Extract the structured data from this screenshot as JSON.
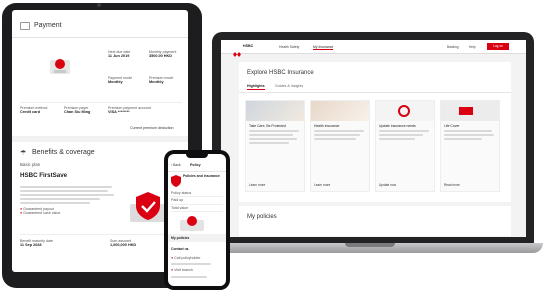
{
  "tablet": {
    "payment": {
      "title": "Payment",
      "fields": [
        {
          "label": "Next due date",
          "value": "11 Jun 2019"
        },
        {
          "label": "Monthly payment",
          "value": "3500.00 HKD"
        },
        {
          "label": "Payment mode",
          "value": "Monthly"
        },
        {
          "label": "Premium mode",
          "value": "Monthly"
        },
        {
          "label": "Premium method",
          "value": "Credit card"
        },
        {
          "label": "Premium payer",
          "value": "Chan Siu Ming"
        },
        {
          "label": "Premium payment account",
          "value": "VISA ********"
        }
      ],
      "link": "Current premium deduction"
    },
    "benefits": {
      "title": "Benefits & coverage",
      "plan_label": "Basic plan",
      "plan_name": "HSBC FirstSave",
      "bullets": [
        "Guaranteed payout",
        "Guaranteed cash value"
      ],
      "footer": [
        {
          "label": "Benefit maturity date",
          "value": "11 Sep 2028"
        },
        {
          "label": "Sum assured",
          "value": "1,000,000 HKD"
        }
      ]
    }
  },
  "laptop": {
    "nav": {
      "brand": "HSBC",
      "links": [
        "Health Safety",
        "My Insurance"
      ],
      "right": [
        "Banking",
        "Help"
      ],
      "cta": "Log on"
    },
    "heading": "Explore HSBC Insurance",
    "tabs": [
      "Highlights",
      "Guides & Insights"
    ],
    "cards": [
      {
        "title": "Take Care, Be Protected",
        "link": "Learn more"
      },
      {
        "title": "Health insurance",
        "link": "Learn more"
      },
      {
        "title": "Update insurance needs",
        "link": "Update now"
      },
      {
        "title": "Life Cover",
        "link": "Read more"
      }
    ],
    "section": "My policies"
  },
  "phone": {
    "back": "Back",
    "title": "Policy",
    "heading": "Policies and insurance",
    "rows": [
      "Policy status",
      "Paid up",
      "Total value"
    ],
    "selected": "My policies",
    "contact": "Contact us",
    "items": [
      "Call policyholder",
      "Visit branch"
    ],
    "colors": {
      "brand": "#db0011"
    }
  }
}
